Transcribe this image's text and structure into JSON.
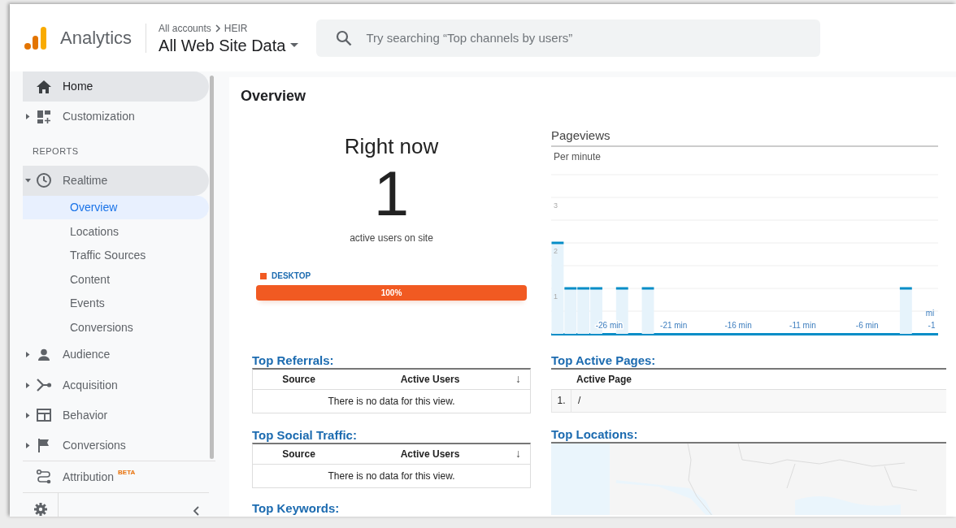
{
  "header": {
    "app_name": "Analytics",
    "breadcrumb": [
      "All accounts",
      "HEIR"
    ],
    "property": "All Web Site Data",
    "search": {
      "placeholder": "Try searching “Top channels by users”"
    }
  },
  "sidebar": {
    "items": [
      {
        "kind": "item",
        "label": "Home",
        "selected": true
      },
      {
        "kind": "item",
        "label": "Customization",
        "selected": false,
        "expanded": false
      },
      {
        "kind": "section",
        "label": "REPORTS"
      },
      {
        "kind": "item",
        "label": "Realtime",
        "selected": false,
        "expanded": true,
        "children": [
          {
            "label": "Overview",
            "selected": true
          },
          {
            "label": "Locations",
            "selected": false
          },
          {
            "label": "Traffic Sources",
            "selected": false
          },
          {
            "label": "Content",
            "selected": false
          },
          {
            "label": "Events",
            "selected": false
          },
          {
            "label": "Conversions",
            "selected": false
          }
        ]
      },
      {
        "kind": "item",
        "label": "Audience",
        "selected": false,
        "expanded": false
      },
      {
        "kind": "item",
        "label": "Acquisition",
        "selected": false,
        "expanded": false
      },
      {
        "kind": "item",
        "label": "Behavior",
        "selected": false,
        "expanded": false
      },
      {
        "kind": "item",
        "label": "Conversions",
        "selected": false,
        "expanded": false
      }
    ],
    "attribution": {
      "label": "Attribution",
      "badge": "BETA"
    }
  },
  "overview": {
    "title": "Overview",
    "right_now": {
      "title": "Right now",
      "count": "1",
      "caption": "active users on site",
      "devices": [
        {
          "label": "DESKTOP",
          "color": "#f15a22",
          "level": 1,
          "reading": "100%"
        }
      ]
    },
    "pageviews": {
      "title": "Pageviews",
      "subtitle": "Per minute",
      "chart_data": {
        "type": "bar",
        "grid": true,
        "xlim": [
          -30.5,
          -0.5
        ],
        "x": [
          -30,
          -29,
          -28,
          -27,
          -26,
          -25,
          -24,
          -23,
          -22,
          -21,
          -20,
          -19,
          -18,
          -17,
          -16,
          -15,
          -14,
          -13,
          -12,
          -11,
          -10,
          -9,
          -8,
          -7,
          -6,
          -5,
          -4,
          -3,
          -2,
          -1
        ],
        "series": [
          {
            "color": "#e6f3fb",
            "values": [
              2,
              1,
              1,
              1,
              0,
              1,
              0,
              1,
              0,
              0,
              0,
              0,
              0,
              0,
              0,
              0,
              0,
              0,
              0,
              0,
              0,
              0,
              0,
              0,
              0,
              0,
              0,
              1,
              0,
              0
            ]
          }
        ],
        "ylim": [
          0,
          3.5
        ],
        "yticks": [
          1,
          2,
          3
        ],
        "xticks": [
          {
            "value": -26,
            "label": "-26 min"
          },
          {
            "value": -21,
            "label": "-21 min"
          },
          {
            "value": -16,
            "label": "-16 min"
          },
          {
            "value": -11,
            "label": "-11 min"
          },
          {
            "value": -6,
            "label": "-6 min"
          },
          {
            "value": -1,
            "label": "-1"
          }
        ],
        "annotations": [
          "mi"
        ]
      }
    },
    "top_referrals": {
      "title": "Top Referrals:",
      "columns": [
        "Source",
        "Active Users"
      ],
      "sort_indicator": "↓",
      "empty_message": "There is no data for this view."
    },
    "top_social_traffic": {
      "title": "Top Social Traffic:",
      "columns": [
        "Source",
        "Active Users"
      ],
      "sort_indicator": "↓",
      "empty_message": "There is no data for this view."
    },
    "top_keywords": {
      "title": "Top Keywords:"
    },
    "top_active_pages": {
      "title": "Top Active Pages:",
      "columns": [
        "Active Page"
      ],
      "rows": [
        {
          "rank": "1.",
          "page": "/"
        }
      ]
    },
    "top_locations": {
      "title": "Top Locations:"
    }
  }
}
